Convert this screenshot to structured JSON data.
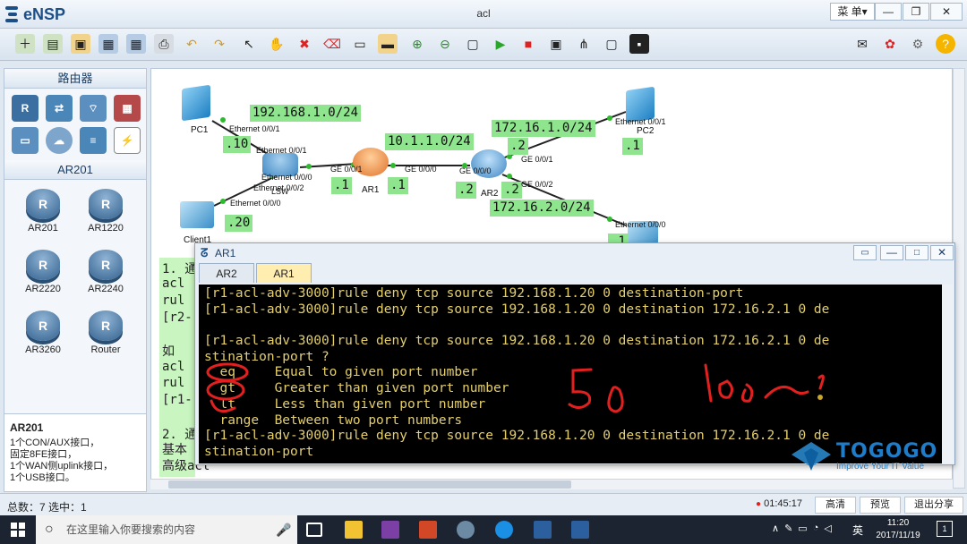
{
  "app": {
    "name": "eNSP",
    "window_title": "acl",
    "menu_label": "菜 单▾"
  },
  "window_controls": {
    "minimize": "—",
    "restore": "❐",
    "close": "✕"
  },
  "toolbar_icons": [
    "new-topology-icon",
    "new-sample-icon",
    "open-icon",
    "save-icon",
    "save-as-icon",
    "print-icon",
    "undo-icon",
    "redo-icon",
    "select-icon",
    "pan-hand-icon",
    "delete-icon",
    "delete-link-icon",
    "text-note-icon",
    "palette-icon",
    "zoom-in-icon",
    "zoom-out-icon",
    "fit-icon",
    "start-device-icon",
    "stop-device-icon",
    "capture-icon",
    "topology-icon",
    "grid-icon",
    "cli-icon",
    "chat-icon",
    "huawei-icon",
    "settings-icon",
    "help-icon"
  ],
  "sidebar": {
    "category_title": "路由器",
    "category_icons": [
      "router-icon",
      "switch-icon",
      "wireless-icon",
      "firewall-icon",
      "pc-icon",
      "cloud-icon",
      "other-device-icon",
      "link-icon"
    ],
    "model_title": "AR201",
    "devices": [
      {
        "label": "AR201"
      },
      {
        "label": "AR1220"
      },
      {
        "label": "AR2220"
      },
      {
        "label": "AR2240"
      },
      {
        "label": "AR3260"
      },
      {
        "label": "Router"
      }
    ],
    "info": {
      "name": "AR201",
      "lines": [
        "1个CON/AUX接口，",
        "固定8FE接口，",
        "1个WAN侧uplink接口，",
        "1个USB接口。"
      ]
    }
  },
  "topology": {
    "devices": {
      "pc1": "PC1",
      "pc2": "PC2",
      "client1": "Client1",
      "ar1": "AR1",
      "ar2": "AR2",
      "lsw": "LSW"
    },
    "labels": {
      "net1": "192.168.1.0/24",
      "net2": "10.1.1.0/24",
      "net3": "172.16.1.0/24",
      "net4": "172.16.2.0/24",
      "pc1_host": ".10",
      "client_host": ".20",
      "ar1_host_a": ".1",
      "ar1_host_b": ".1",
      "ar2_host_a": ".2",
      "ar2_host_b": ".2",
      "ar2_host_c": ".2",
      "pc2_host": ".1",
      "server_host": ".1"
    },
    "interfaces": {
      "pc1_eth": "Ethernet 0/0/1",
      "sw_eth1": "Ethernet 0/0/1",
      "sw_eth0": "Ethernet 0/0/0",
      "sw_eth2": "Ethernet 0/0/2",
      "client_eth": "Ethernet 0/0/0",
      "ar1_ge001": "GE 0/0/1",
      "ar1_ge000": "GE 0/0/0",
      "ar2_ge000": "GE 0/0/0",
      "ar2_ge001": "GE 0/0/1",
      "ar2_ge002": "GE 0/0/2",
      "pc2_eth": "Ethernet 0/0/1",
      "server_eth": "Ethernet 0/0/0"
    }
  },
  "background_text": {
    "lines": [
      "1. 通",
      "acl",
      " rul",
      "[r2-",
      "  如",
      "acl",
      " rul",
      "[r1-",
      "2. 通",
      "基本",
      "高级acl"
    ]
  },
  "terminal": {
    "title": "AR1",
    "tabs": [
      {
        "label": "AR2"
      },
      {
        "label": "AR1"
      }
    ],
    "lines": [
      "[r1-acl-adv-3000]rule deny tcp source 192.168.1.20 0 destination-port",
      "[r1-acl-adv-3000]rule deny tcp source 192.168.1.20 0 destination 172.16.2.1 0 de",
      "",
      "[r1-acl-adv-3000]rule deny tcp source 192.168.1.20 0 destination 172.16.2.1 0 de",
      "stination-port ?",
      "  eq     Equal to given port number",
      "  gt     Greater than given port number",
      "  lt     Less than given port number",
      "  range  Between two port numbers",
      "[r1-acl-adv-3000]rule deny tcp source 192.168.1.20 0 destination 172.16.2.1 0 de",
      "stination-port"
    ]
  },
  "watermark": {
    "brand": "TOGOGO",
    "tagline": "Improve Your IT Value"
  },
  "status": {
    "left": "总数：7  选中：1",
    "recording_time": "01:45:17",
    "buttons": [
      {
        "label": "高清"
      },
      {
        "label": "预览"
      },
      {
        "label": "退出分享"
      }
    ]
  },
  "taskbar": {
    "search_placeholder": "在这里输入你要搜索的内容",
    "ime": "英",
    "time": "11:20",
    "date": "2017/11/19",
    "notification_count": "1"
  },
  "colors": {
    "accent": "#1d4f87",
    "label_green": "#8ee58e",
    "terminal_text": "#e4cf6b",
    "annotation_red": "#e32020"
  }
}
